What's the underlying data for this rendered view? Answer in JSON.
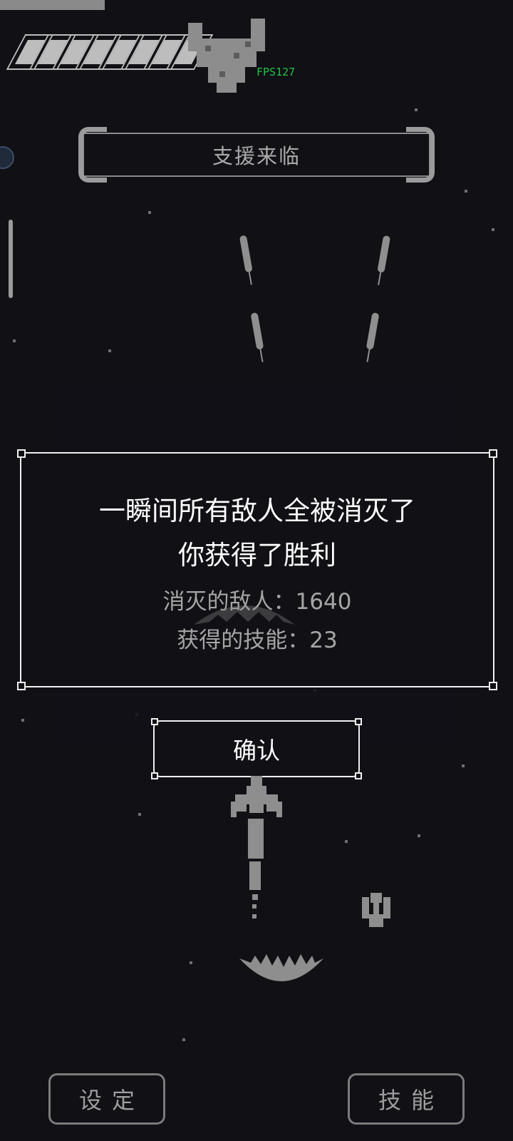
{
  "hud": {
    "fps": "FPS127",
    "health_segments_total": 8,
    "health_segments_filled": 8
  },
  "banner": {
    "label": "支援来临"
  },
  "dialog": {
    "line1": "一瞬间所有敌人全被消灭了",
    "line2": "你获得了胜利",
    "enemies_label": "消灭的敌人：1640",
    "skills_label": "获得的技能：23"
  },
  "confirm_button": {
    "label": "确认"
  },
  "bottom": {
    "settings_label": "设定",
    "skills_label": "技能"
  },
  "colors": {
    "fps": "#21c447",
    "background": "#111015",
    "frame": "#f0f0f0"
  }
}
